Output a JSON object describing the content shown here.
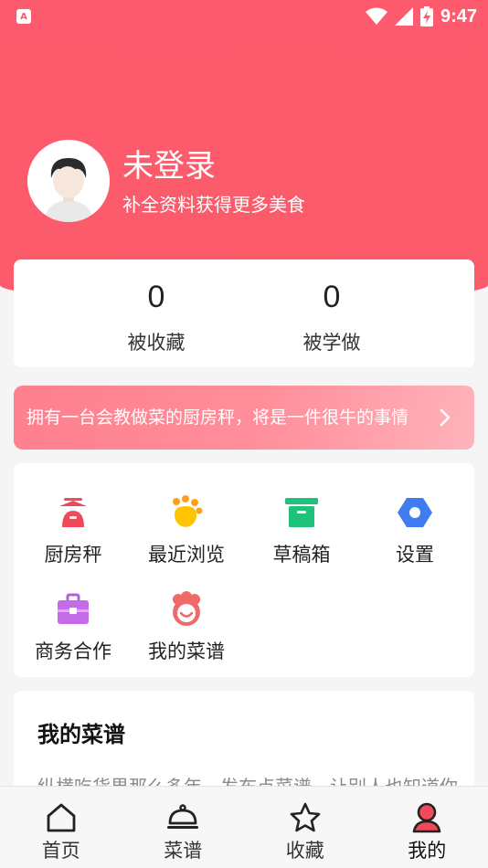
{
  "status_bar": {
    "app_icon_letter": "A",
    "time": "9:47"
  },
  "profile": {
    "name": "未登录",
    "subtitle": "补全资料获得更多美食"
  },
  "stats": [
    {
      "value": "0",
      "label": "被收藏"
    },
    {
      "value": "0",
      "label": "被学做"
    }
  ],
  "banner": {
    "text": "拥有一台会教做菜的厨房秤，将是一件很牛的事情"
  },
  "menu": [
    {
      "label": "厨房秤",
      "icon": "kitchen-scale-icon",
      "color": "#f04a5a"
    },
    {
      "label": "最近浏览",
      "icon": "paw-icon",
      "color": "#ffb400"
    },
    {
      "label": "草稿箱",
      "icon": "draft-box-icon",
      "color": "#1fc27a"
    },
    {
      "label": "设置",
      "icon": "settings-icon",
      "color": "#3f7cf0"
    },
    {
      "label": "商务合作",
      "icon": "briefcase-icon",
      "color": "#c66be8"
    },
    {
      "label": "我的菜谱",
      "icon": "chef-face-icon",
      "color": "#f06a6a"
    }
  ],
  "recipes": {
    "title": "我的菜谱",
    "description": "纵横吃货界那么多年，发布点菜谱，让别人也知道你"
  },
  "tabs": [
    {
      "label": "首页",
      "icon": "home-icon"
    },
    {
      "label": "菜谱",
      "icon": "cloche-icon"
    },
    {
      "label": "收藏",
      "icon": "star-icon"
    },
    {
      "label": "我的",
      "icon": "user-icon",
      "active": true
    }
  ],
  "colors": {
    "brand": "#fb5b6a"
  }
}
